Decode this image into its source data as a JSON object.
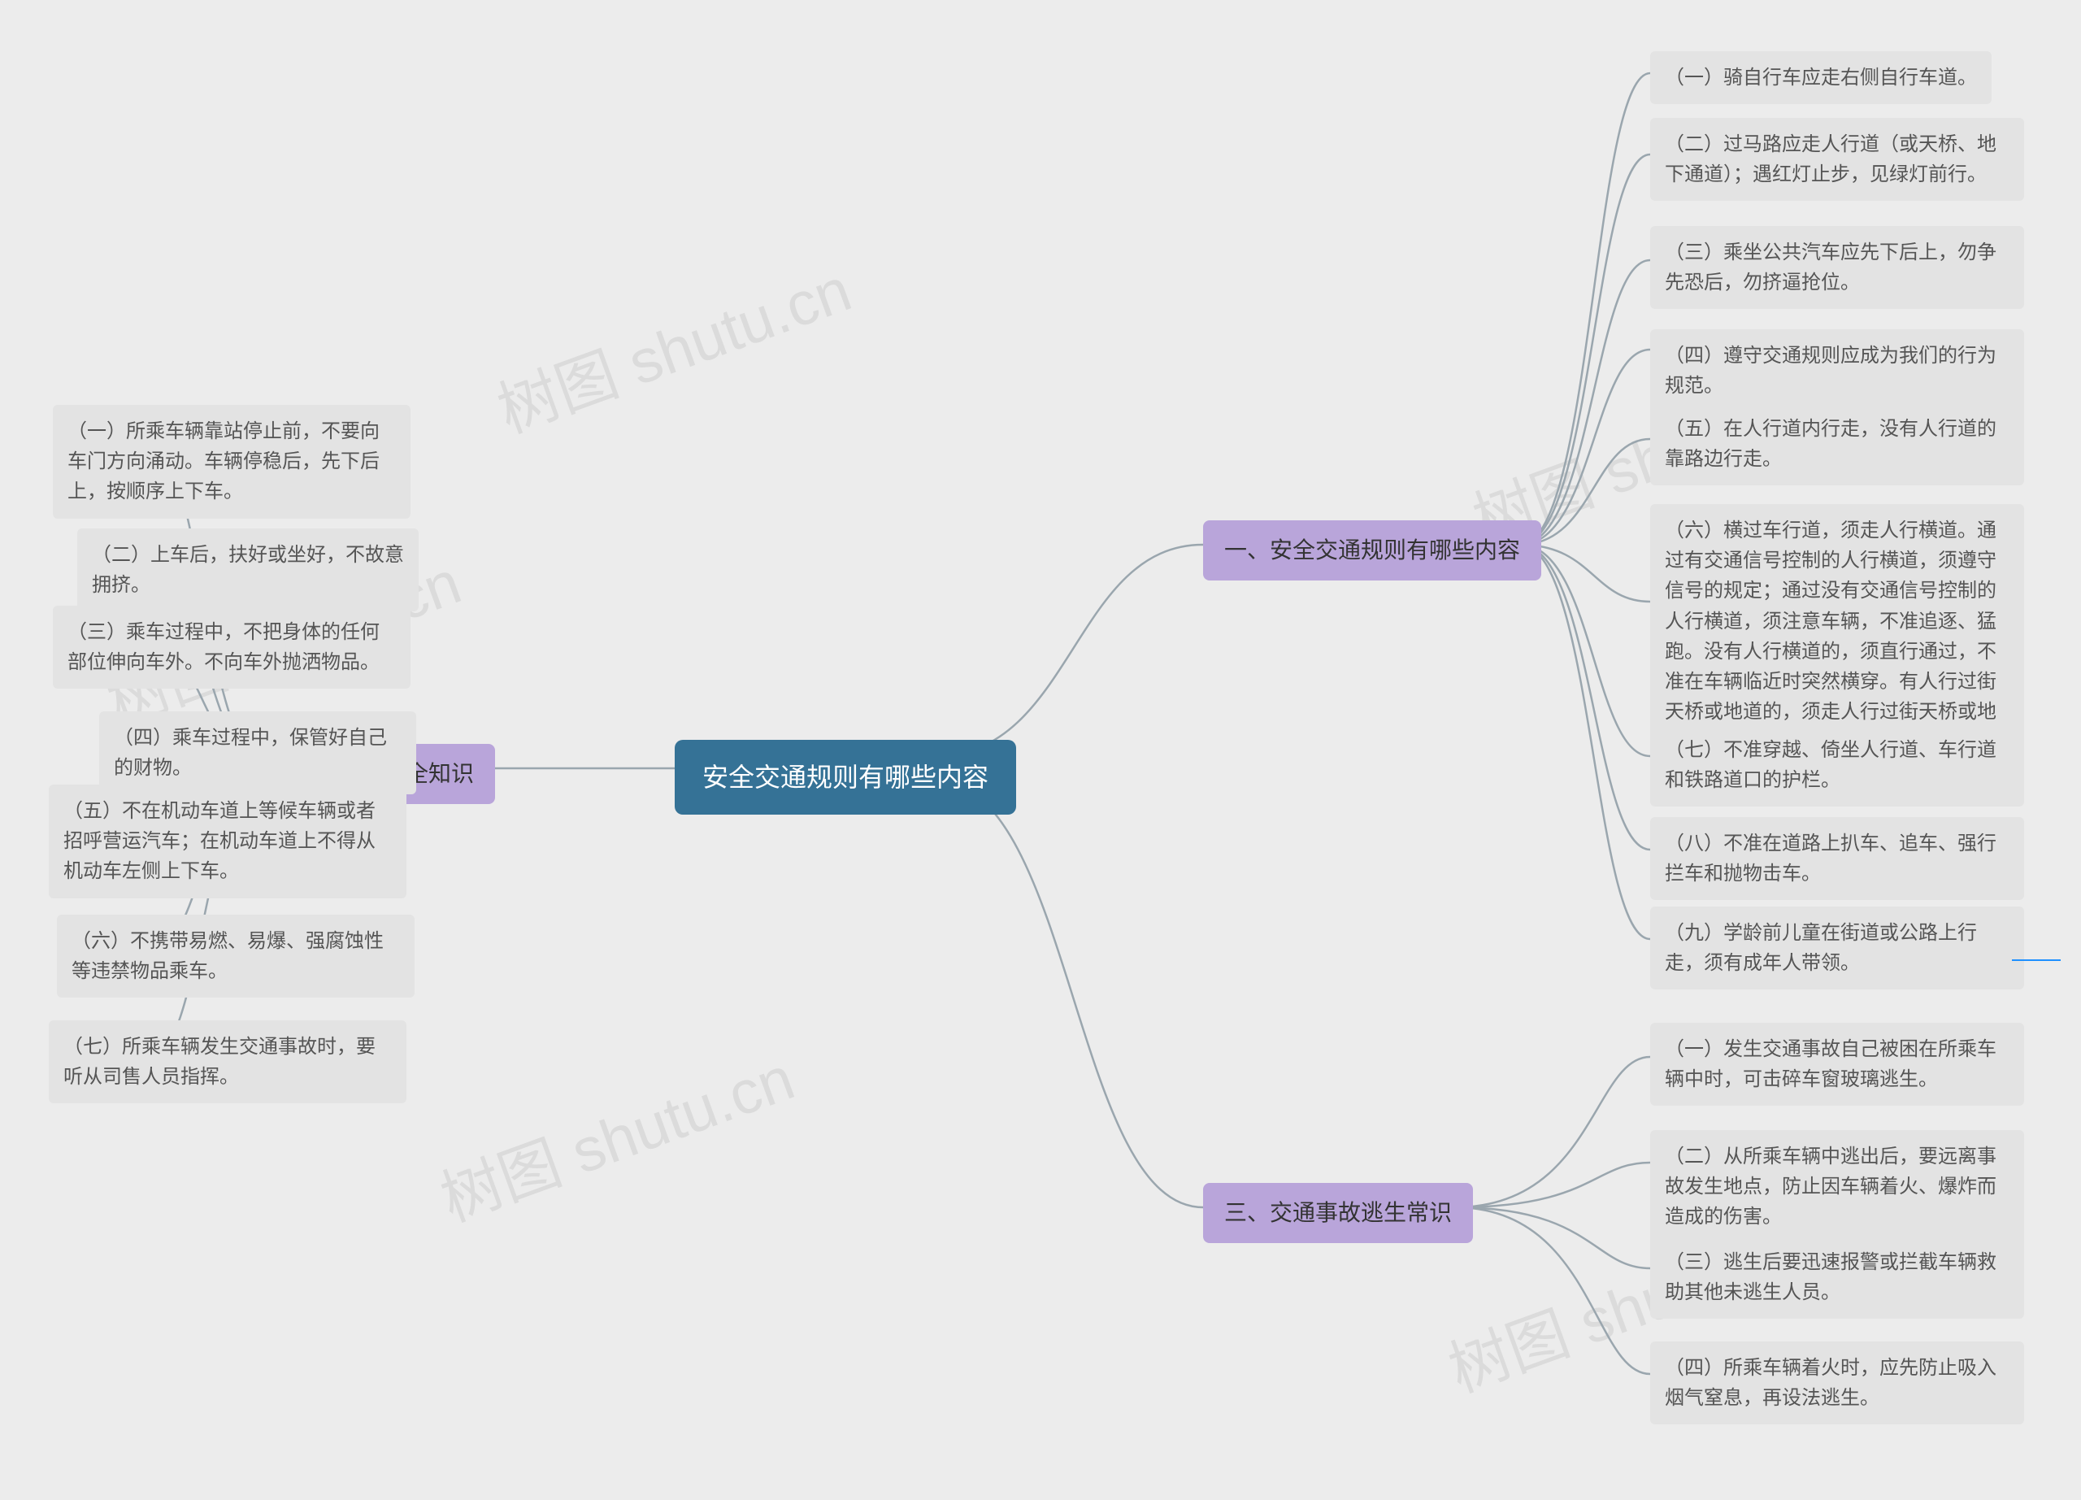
{
  "watermarks": [
    {
      "text": "树图 shutu.cn"
    },
    {
      "text": "树图 shutu.cn"
    },
    {
      "text": "树图 shutu.cn"
    },
    {
      "text": "树图 shutu.cn"
    },
    {
      "text": "树图 shutu.cn"
    }
  ],
  "root": {
    "label": "安全交通规则有哪些内容"
  },
  "branch1": {
    "label": "一、安全交通规则有哪些内容",
    "items": [
      "（一）骑自行车应走右侧自行车道。",
      "（二）过马路应走人行道（或天桥、地下通道）；遇红灯止步，见绿灯前行。",
      "（三）乘坐公共汽车应先下后上，勿争先恐后，勿挤逼抢位。",
      "（四）遵守交通规则应成为我们的行为规范。",
      "（五）在人行道内行走，没有人行道的靠路边行走。",
      "（六）横过车行道，须走人行横道。通过有交通信号控制的人行横道，须遵守信号的规定；通过没有交通信号控制的人行横道，须注意车辆，不准追逐、猛跑。没有人行横道的，须直行通过，不准在车辆临近时突然横穿。有人行过街天桥或地道的，须走人行过街天桥或地道。",
      "（七）不准穿越、倚坐人行道、车行道和铁路道口的护栏。",
      "（八）不准在道路上扒车、追车、强行拦车和抛物击车。",
      "（九）学龄前儿童在街道或公路上行走，须有成年人带领。"
    ]
  },
  "branch2": {
    "label": "二、乘车安全知识",
    "items": [
      "（一）所乘车辆靠站停止前，不要向车门方向涌动。车辆停稳后，先下后上，按顺序上下车。",
      "（二）上车后，扶好或坐好，不故意拥挤。",
      "（三）乘车过程中，不把身体的任何部位伸向车外。不向车外抛洒物品。",
      "（四）乘车过程中，保管好自己的财物。",
      "（五）不在机动车道上等候车辆或者招呼营运汽车；在机动车道上不得从机动车左侧上下车。",
      "（六）不携带易燃、易爆、强腐蚀性等违禁物品乘车。",
      "（七）所乘车辆发生交通事故时，要听从司售人员指挥。"
    ]
  },
  "branch3": {
    "label": "三、交通事故逃生常识",
    "items": [
      "（一）发生交通事故自己被困在所乘车辆中时，可击碎车窗玻璃逃生。",
      "（二）从所乘车辆中逃出后，要远离事故发生地点，防止因车辆着火、爆炸而造成的伤害。",
      "（三）逃生后要迅速报警或拦截车辆救助其他未逃生人员。",
      "（四）所乘车辆着火时，应先防止吸入烟气窒息，再设法逃生。"
    ]
  }
}
